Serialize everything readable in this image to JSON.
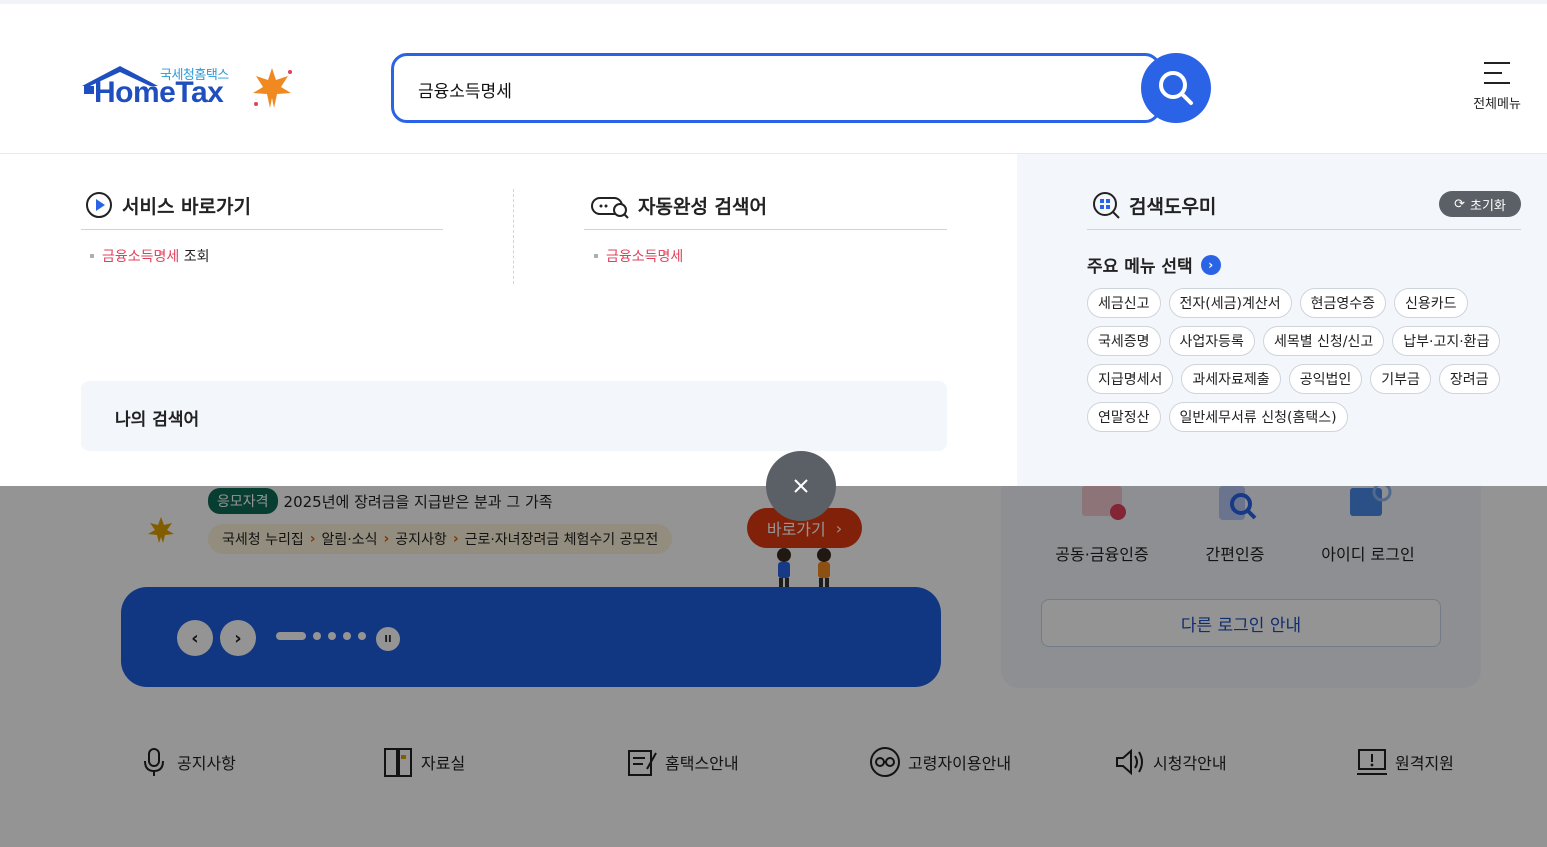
{
  "colors": {
    "brand_blue": "#2a63e6",
    "highlight": "#e0405a",
    "dim_overlay": "rgba(0,0,0,0.42)",
    "go_button": "#e03a10"
  },
  "logo": {
    "subtitle": "국세청홈택스",
    "title": "HomeTax"
  },
  "search": {
    "value": "금융소득명세",
    "button_icon": "search-icon"
  },
  "menu": {
    "label": "전체메뉴"
  },
  "service_shortcut": {
    "title": "서비스 바로가기",
    "results": [
      {
        "highlight": "금융소득명세",
        "rest": " 조회"
      }
    ]
  },
  "autocomplete": {
    "title": "자동완성 검색어",
    "results": [
      {
        "highlight": "금융소득명세",
        "rest": ""
      }
    ]
  },
  "my_search": {
    "title": "나의 검색어"
  },
  "search_helper": {
    "title": "검색도우미",
    "reset_label": "초기화",
    "menu_select_label": "주요 메뉴 선택",
    "chips": [
      "세금신고",
      "전자(세금)계산서",
      "현금영수증",
      "신용카드",
      "국세증명",
      "사업자등록",
      "세목별 신청/신고",
      "납부·고지·환급",
      "지급명세서",
      "과세자료제출",
      "공익법인",
      "기부금",
      "장려금",
      "연말정산",
      "일반세무서류 신청(홈택스)"
    ]
  },
  "banner": {
    "tag": "응모자격",
    "headline": "2025년에 장려금을 지급받은 분과 그 가족",
    "breadcrumb": [
      "국세청 누리집",
      "알림·소식",
      "공지사항",
      "근로·자녀장려금 체험수기 공모전"
    ],
    "go_label": "바로가기",
    "slide_total": 5,
    "slide_current": 1
  },
  "login": {
    "options": [
      "공동·금융인증",
      "간편인증",
      "아이디 로그인"
    ],
    "other_label": "다른 로그인 안내"
  },
  "quick_links": [
    "공지사항",
    "자료실",
    "홈택스안내",
    "고령자이용안내",
    "시청각안내",
    "원격지원"
  ]
}
